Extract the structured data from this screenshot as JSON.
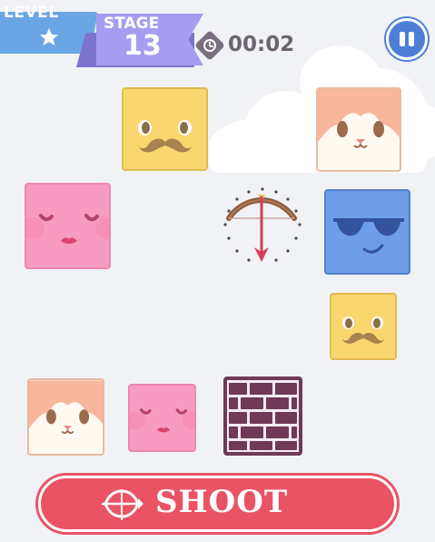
{
  "hud": {
    "level_label": "LEVEL",
    "stage_label": "STAGE",
    "stage_number": "13",
    "timer": "00:02"
  },
  "icons": {
    "level": "star-icon",
    "timer": "clock-icon",
    "pause": "pause-icon",
    "shooter": "bow-arrow-icon",
    "shoot": "crossbow-icon"
  },
  "blocks": [
    {
      "name": "yellow-mustache-block",
      "face": "mustache"
    },
    {
      "name": "cat-block",
      "face": "cat"
    },
    {
      "name": "pink-block",
      "face": "blush"
    },
    {
      "name": "blue-sunglasses-block",
      "face": "sunglasses"
    },
    {
      "name": "yellow-mustache-block",
      "face": "mustache"
    },
    {
      "name": "cat-block",
      "face": "cat"
    },
    {
      "name": "pink-block",
      "face": "blush"
    },
    {
      "name": "brick-wall-block",
      "face": "bricks"
    }
  ],
  "shoot_button": {
    "label": "SHOOT"
  },
  "colors": {
    "background": "#f1f2f6",
    "yellow": "#f8d76e",
    "pink": "#f79bc1",
    "blue": "#6d9ee7",
    "cat_top": "#f8b69c",
    "brick": "#6e3a55",
    "shoot": "#ea5364",
    "level_badge": "#6aa6e4",
    "stage_ribbon": "#a79df0",
    "pause": "#4d7fd6"
  }
}
